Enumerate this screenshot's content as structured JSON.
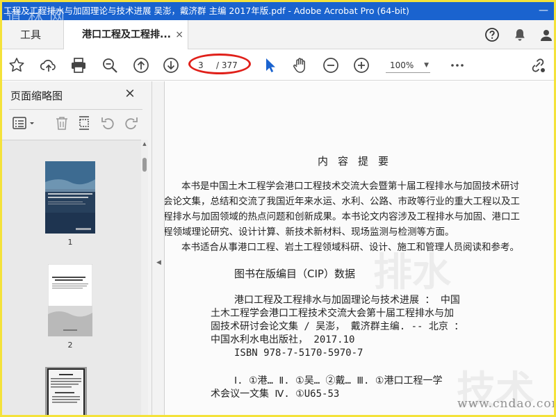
{
  "window": {
    "title": "工程及工程排水与加固理论与技术进展 吴澎，戴济群 主编 2017年版.pdf - Adobe Acrobat Pro (64-bit)",
    "watermark_top": "道 林 网",
    "watermark_bottom": "www.cndao.com"
  },
  "tabs": {
    "tools_label": "工具",
    "doc_tab_label": "港口工程及工程排...",
    "doc_tab_close": "×"
  },
  "toolbar": {
    "current_page": "3",
    "total_pages": "/ 377",
    "zoom": "100%"
  },
  "panel": {
    "title": "页面缩略图",
    "close": "×",
    "thumbnails": [
      {
        "label": "1",
        "cover_title": "港口工程及工程排水与加固理论与技术进展"
      },
      {
        "label": "2",
        "cover_title": "港口工程及工程排水与加固理论与技术进展"
      },
      {
        "label": ""
      }
    ]
  },
  "document": {
    "heading": "内容提要",
    "paragraphs": [
      "本书是中国土木工程学会港口工程技术交流大会暨第十届工程排水与加固技术研讨",
      "会论文集，总结和交流了我国近年来水运、水利、公路、市政等行业的重大工程以及工",
      "程排水与加固领域的热点问题和创新成果。本书论文内容涉及工程排水与加固、港口工",
      "程领域理论研究、设计计算、新技术新材料、现场监测与检测等方面。",
      "本书适合从事港口工程、岩土工程领域科研、设计、施工和管理人员阅读和参考。"
    ],
    "cip_title": "图书在版编目（CIP）数据",
    "cip_lines": [
      "港口工程及工程排水与加固理论与技术进展 ： 中国",
      "土木工程学会港口工程技术交流大会第十届工程排水与加",
      "固技术研讨会论文集 / 吴澎， 戴济群主编. -- 北京 ：",
      "中国水利水电出版社， 2017.10",
      "ISBN 978-7-5170-5970-7",
      "",
      "Ⅰ. ①港… Ⅱ. ①吴… ②戴… Ⅲ. ①港口工程一学",
      "术会议一文集 Ⅳ. ①U65-53"
    ]
  }
}
